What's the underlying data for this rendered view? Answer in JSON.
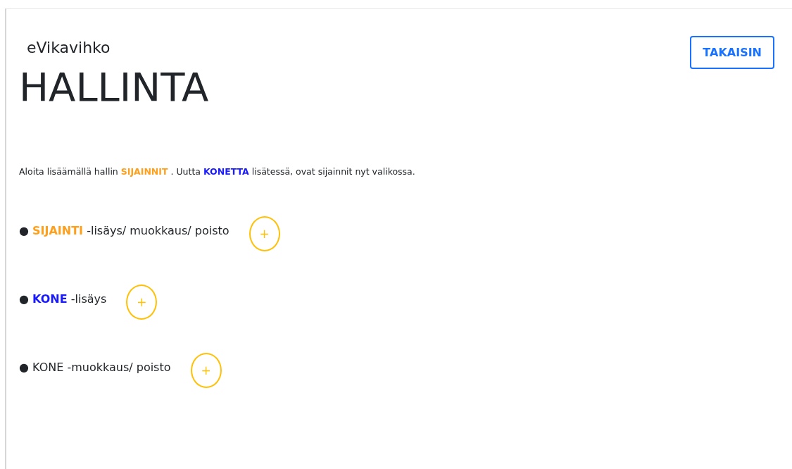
{
  "app_name": "eVikavihko",
  "back_button": "TAKAISIN",
  "heading": "HALLINTA",
  "intro": [
    {
      "text": "Aloita lisäämällä hallin "
    },
    {
      "text": "SIJAINNIT",
      "color": "#ff9f1a"
    },
    {
      "text": " . Uutta "
    },
    {
      "text": "KONETTA",
      "color": "#1a1aff"
    },
    {
      "text": " lisätessä, ovat sijainnit nyt valikossa."
    }
  ],
  "items": [
    {
      "bullet": "●",
      "segments": [
        {
          "text": "SIJAINTI",
          "color": "#ff9f1a"
        },
        {
          "text": " -lisäys/ muokkaus/ poisto"
        }
      ],
      "add": "+"
    },
    {
      "bullet": "●",
      "segments": [
        {
          "text": "KONE",
          "color": "#1a1aff"
        },
        {
          "text": " -lisäys"
        }
      ],
      "add": "+"
    },
    {
      "bullet": "●",
      "segments": [
        {
          "text": "KONE -muokkaus/ poisto"
        }
      ],
      "add": "+"
    }
  ]
}
